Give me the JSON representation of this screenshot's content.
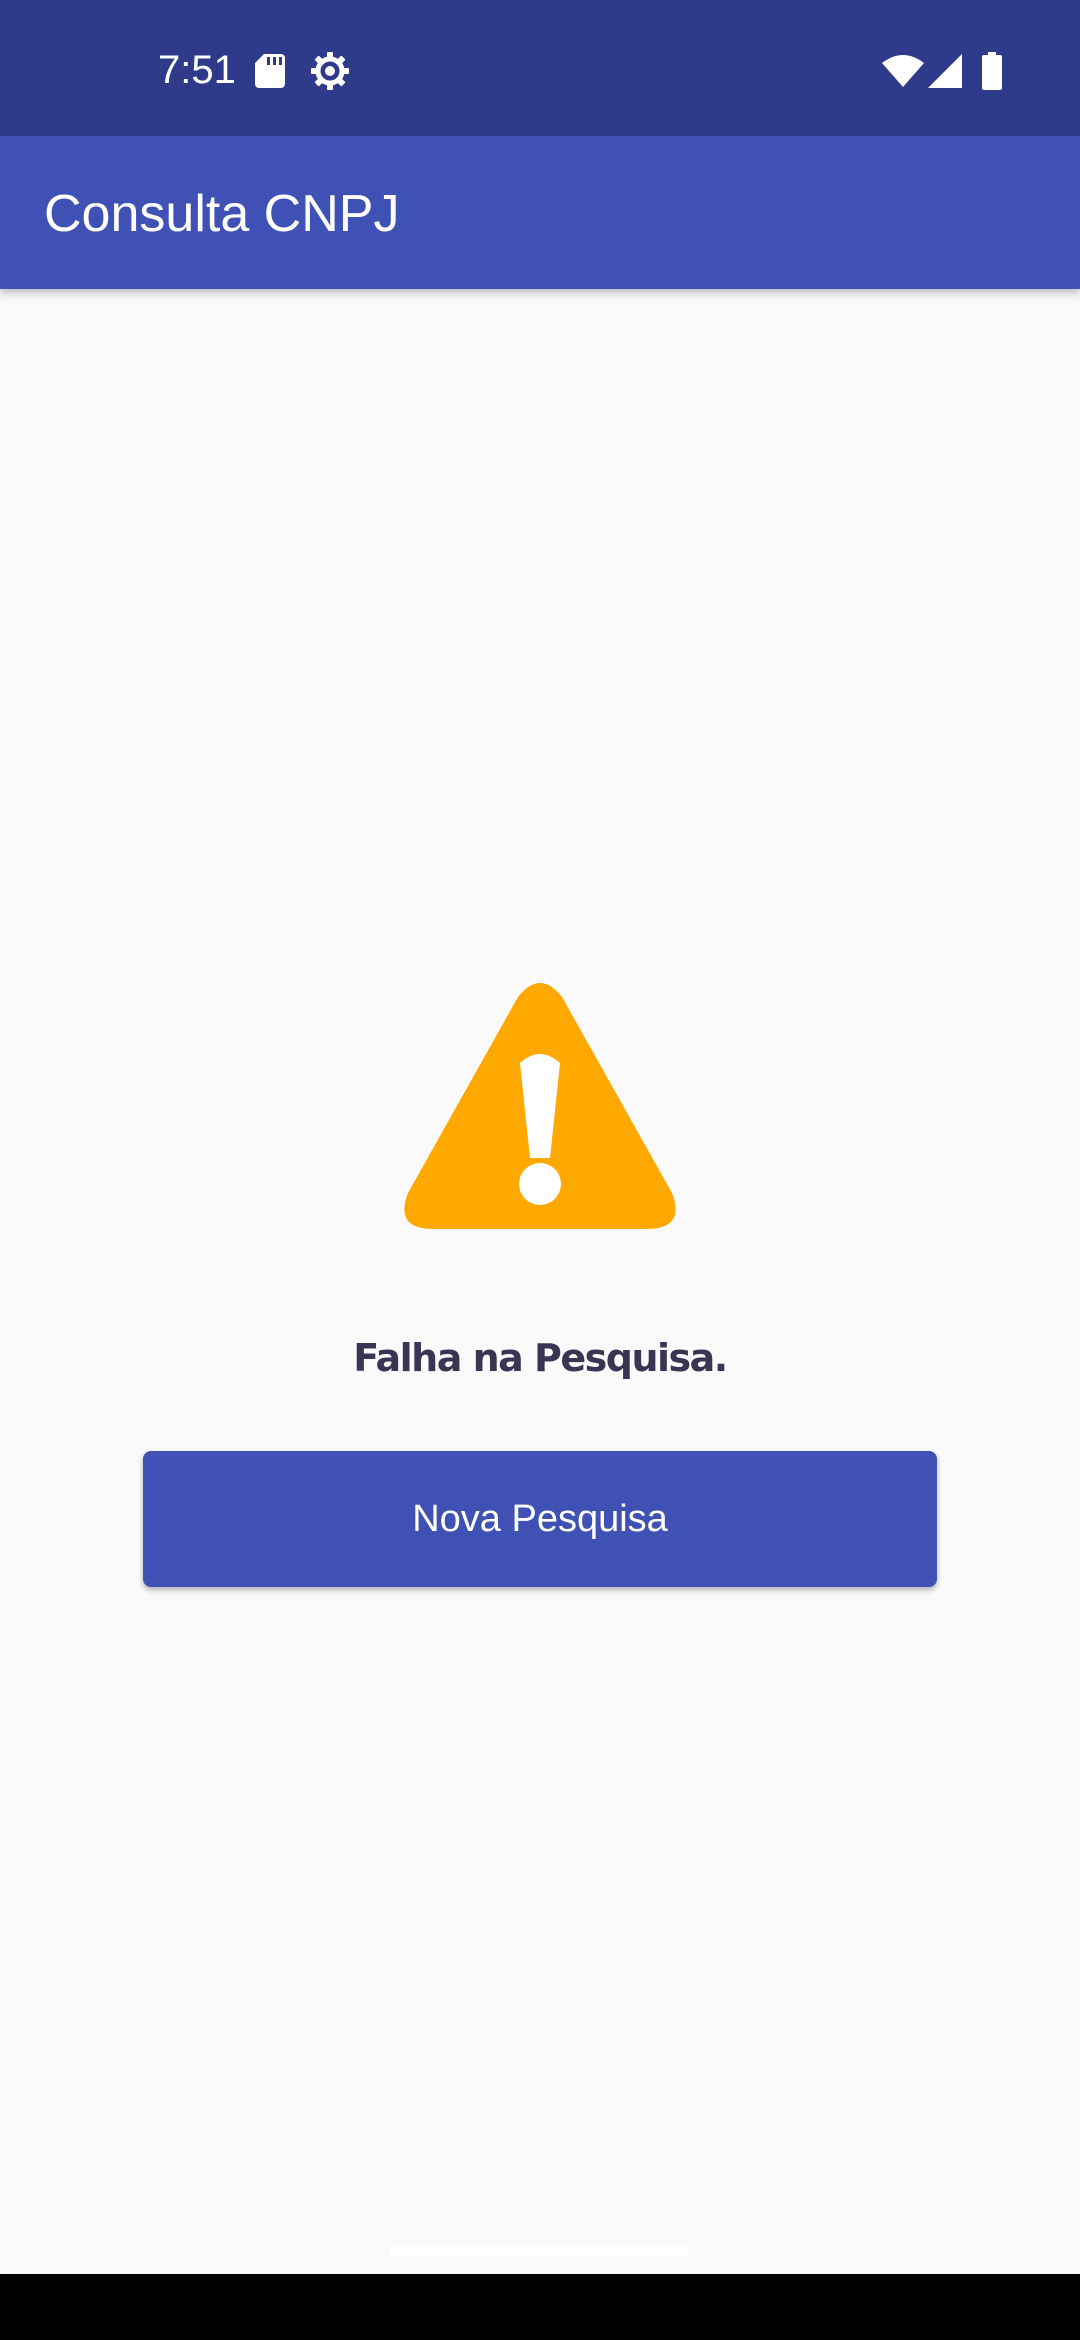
{
  "status_bar": {
    "time": "7:51",
    "icons": [
      "sd-card-icon",
      "settings-gear-icon",
      "wifi-icon",
      "cellular-signal-icon",
      "battery-icon"
    ],
    "background_color": "#2f3b8a"
  },
  "app_bar": {
    "title": "Consulta CNPJ",
    "background_color": "#3f51b5"
  },
  "main": {
    "warning_icon": "warning-triangle-icon",
    "warning_color": "#ffa800",
    "message": "Falha na Pesquisa.",
    "button_label": "Nova Pesquisa",
    "button_color": "#3f51b5"
  },
  "navigation": {
    "home_indicator": "home-handle"
  }
}
